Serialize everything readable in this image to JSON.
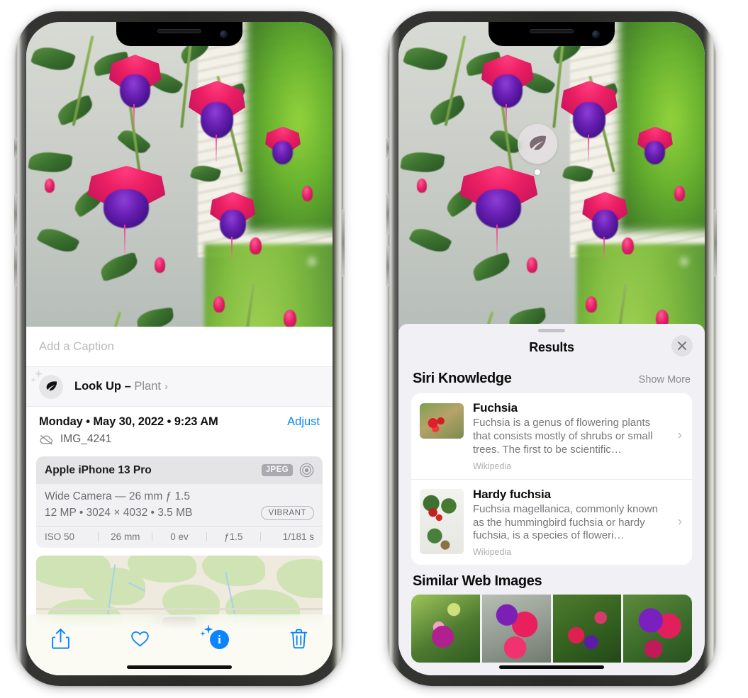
{
  "left_phone": {
    "photo": {
      "alt": "fuchsia-flowers-photo"
    },
    "caption": {
      "placeholder": "Add a Caption",
      "value": ""
    },
    "lookup": {
      "icon": "leaf-icon",
      "label": "Look Up – ",
      "subject": "Plant",
      "chevron": "›"
    },
    "date": {
      "text": "Monday • May 30, 2022 • 9:23 AM",
      "adjust_label": "Adjust",
      "filename": "IMG_4241",
      "cloud_icon": "cloud-slash-icon"
    },
    "exif": {
      "device": "Apple iPhone 13 Pro",
      "format_badge": "JPEG",
      "lens_icon": "aperture-icon",
      "lens": "Wide Camera — 26 mm ƒ 1.5",
      "size": "12 MP • 3024 × 4032 • 3.5 MB",
      "vibrant_badge": "VIBRANT",
      "stats": [
        "ISO 50",
        "26 mm",
        "0 ev",
        "ƒ1.5",
        "1/181 s"
      ]
    },
    "map": {
      "name": "map-preview"
    },
    "toolbar": {
      "share_label": "share-icon",
      "favorite_label": "heart-icon",
      "info_label": "i",
      "info_sparkle": "sparkle-icon",
      "delete_label": "trash-icon"
    }
  },
  "right_phone": {
    "photo": {
      "alt": "fuchsia-flowers-photo"
    },
    "lookup_badge": {
      "icon": "leaf-icon"
    },
    "sheet": {
      "title": "Results",
      "close_label": "✕",
      "siri": {
        "section_title": "Siri Knowledge",
        "show_more": "Show More",
        "items": [
          {
            "title": "Fuchsia",
            "snippet": "Fuchsia is a genus of flowering plants that consists mostly of shrubs or small trees. The first to be scientific…",
            "source": "Wikipedia",
            "chevron": "›"
          },
          {
            "title": "Hardy fuchsia",
            "snippet": "Fuchsia magellanica, commonly known as the hummingbird fuchsia or hardy fuchsia, is a species of floweri…",
            "source": "Wikipedia",
            "chevron": "›"
          }
        ]
      },
      "web": {
        "section_title": "Similar Web Images",
        "thumbs": [
          "web-image-1",
          "web-image-2",
          "web-image-3",
          "web-image-4"
        ]
      }
    }
  },
  "colors": {
    "accent_blue": "#0a84ff",
    "sheet_bg": "#f1f1f5",
    "card_bg": "#ffffff",
    "secondary_text": "#8a8a8f"
  }
}
